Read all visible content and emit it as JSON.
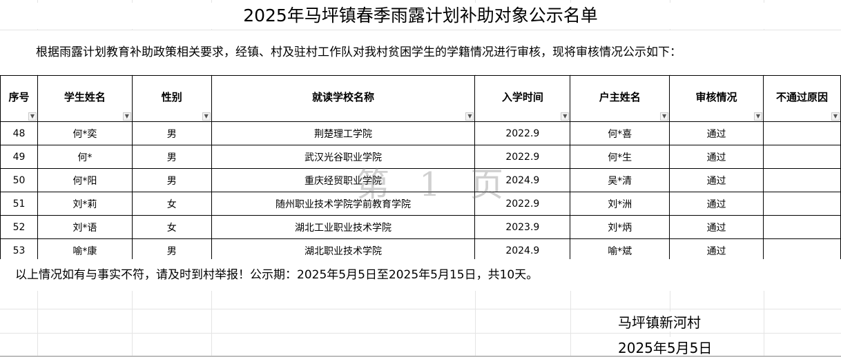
{
  "title": "2025年马坪镇春季雨露计划补助对象公示名单",
  "intro": "根据雨露计划教育补助政策相关要求，经镇、村及驻村工作队对我村贫困学生的学籍情况进行审核，现将审核情况公示如下：",
  "table": {
    "headers": [
      "序号",
      "学生姓名",
      "性别",
      "就读学校名称",
      "入学时间",
      "户主姓名",
      "审核情况",
      "不通过原因"
    ],
    "rows": [
      [
        "48",
        "何*奕",
        "男",
        "荆楚理工学院",
        "2022.9",
        "何*喜",
        "通过",
        ""
      ],
      [
        "49",
        "何*",
        "男",
        "武汉光谷职业学院",
        "2022.9",
        "何*生",
        "通过",
        ""
      ],
      [
        "50",
        "何*阳",
        "男",
        "重庆经贸职业学院",
        "2024.9",
        "吴*清",
        "通过",
        ""
      ],
      [
        "51",
        "刘*莉",
        "女",
        "随州职业技术学院学前教育学院",
        "2022.9",
        "刘*洲",
        "通过",
        ""
      ],
      [
        "52",
        "刘*语",
        "女",
        "湖北工业职业技术学院",
        "2023.9",
        "刘*炳",
        "通过",
        ""
      ],
      [
        "53",
        "喻*康",
        "男",
        "湖北职业技术学院",
        "2024.9",
        "喻*斌",
        "通过",
        ""
      ]
    ]
  },
  "footnote": "以上情况如有与事实不符，请及时到村举报！公示期：2025年5月5日至2025年5月15日，共10天。",
  "signature": {
    "org": "马坪镇新河村",
    "date": "2025年5月5日"
  },
  "watermark": "第 1 页"
}
